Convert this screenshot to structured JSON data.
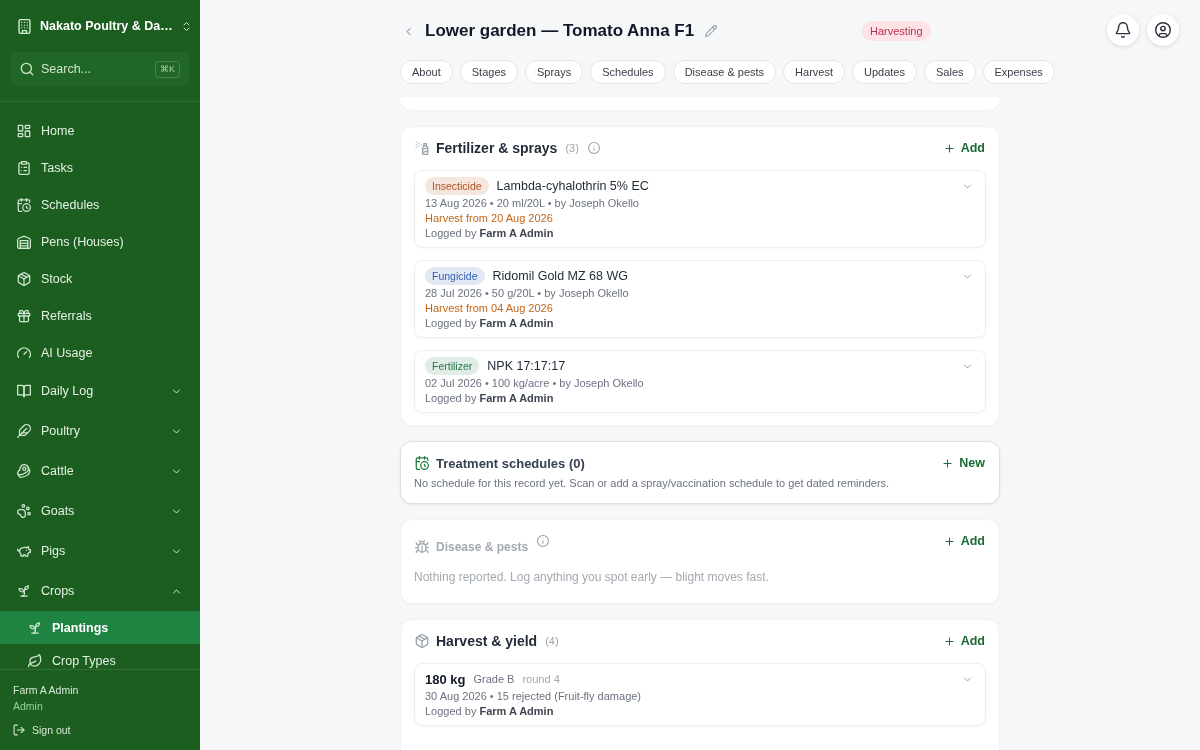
{
  "sidebar": {
    "org": {
      "name": "Nakato Poultry & Da…"
    },
    "search": {
      "placeholder": "Search...",
      "shortcut": "⌘K"
    },
    "items": [
      {
        "kind": "link",
        "label": "Home",
        "selected": false
      },
      {
        "kind": "link",
        "label": "Tasks",
        "selected": false
      },
      {
        "kind": "link",
        "label": "Schedules",
        "selected": false
      },
      {
        "kind": "link",
        "label": "Pens (Houses)",
        "selected": false
      },
      {
        "kind": "link",
        "label": "Stock",
        "selected": false
      },
      {
        "kind": "link",
        "label": "Referrals",
        "selected": false
      },
      {
        "kind": "link",
        "label": "AI Usage",
        "selected": false
      },
      {
        "kind": "group",
        "label": "Daily Log",
        "selected": false,
        "expanded": false
      },
      {
        "kind": "group",
        "label": "Poultry",
        "selected": false,
        "expanded": false
      },
      {
        "kind": "group",
        "label": "Cattle",
        "selected": false,
        "expanded": false
      },
      {
        "kind": "group",
        "label": "Goats",
        "selected": false,
        "expanded": false
      },
      {
        "kind": "group",
        "label": "Pigs",
        "selected": false,
        "expanded": false
      },
      {
        "kind": "group",
        "label": "Crops",
        "selected": false,
        "expanded": true,
        "children": [
          {
            "kind": "link",
            "label": "Plantings",
            "selected": true
          },
          {
            "kind": "link",
            "label": "Crop Types",
            "selected": false
          }
        ]
      }
    ],
    "user": {
      "name": "Farm A Admin",
      "role": "Admin"
    },
    "sign_out": "Sign out"
  },
  "header": {
    "title": "Lower garden — Tomato Anna F1",
    "status": "Harvesting",
    "tabs": [
      {
        "label": "About",
        "selected": false
      },
      {
        "label": "Stages",
        "selected": false
      },
      {
        "label": "Sprays",
        "selected": false
      },
      {
        "label": "Schedules",
        "selected": false
      },
      {
        "label": "Disease & pests",
        "selected": false
      },
      {
        "label": "Harvest",
        "selected": false
      },
      {
        "label": "Updates",
        "selected": false
      },
      {
        "label": "Sales",
        "selected": false
      },
      {
        "label": "Expenses",
        "selected": false
      }
    ]
  },
  "sections": [
    {
      "kind": "records",
      "title": "Fertilizer & sprays",
      "count": "(3)",
      "info": true,
      "action": "Add",
      "items": [
        {
          "tag": "Insecticide",
          "color": "#b4531f",
          "name": "Lambda-cyhalothrin 5% EC",
          "meta": "13 Aug 2026 • 20 ml/20L • by Joseph Okello",
          "harvest_from": "Harvest from 20 Aug 2026",
          "logged_by": "Logged by **Farm A Admin**",
          "expanded": false
        },
        {
          "tag": "Fungicide",
          "color": "#2f5fb3",
          "name": "Ridomil Gold MZ 68 WG",
          "meta": "28 Jul 2026 • 50 g/20L • by Joseph Okello",
          "harvest_from": "Harvest from 04 Aug 2026",
          "logged_by": "Logged by **Farm A Admin**",
          "expanded": false
        },
        {
          "tag": "Fertilizer",
          "color": "#1f7a47",
          "name": "NPK 17:17:17",
          "meta": "02 Jul 2026 • 100 kg/acre • by Joseph Okello",
          "logged_by": "Logged by **Farm A Admin**",
          "expanded": false
        }
      ]
    },
    {
      "kind": "schedules",
      "title": "Treatment schedules (0)",
      "action": "New",
      "description": "No schedule for this record yet. Scan or add a spray/vaccination schedule to get dated reminders."
    },
    {
      "kind": "empty",
      "title": "Disease & pests",
      "info": true,
      "action": "Add",
      "text": "Nothing reported. Log anything you spot early — blight moves fast."
    },
    {
      "kind": "harvest",
      "title": "Harvest & yield",
      "count": "(4)",
      "action": "Add",
      "items": [
        {
          "amount": "180 kg",
          "grade": "Grade B",
          "round": "round 4",
          "meta": "30 Aug 2026 • 15 rejected (Fruit-fly damage)",
          "logged_by": "Logged by **Farm A Admin**",
          "expanded": false
        }
      ]
    }
  ]
}
